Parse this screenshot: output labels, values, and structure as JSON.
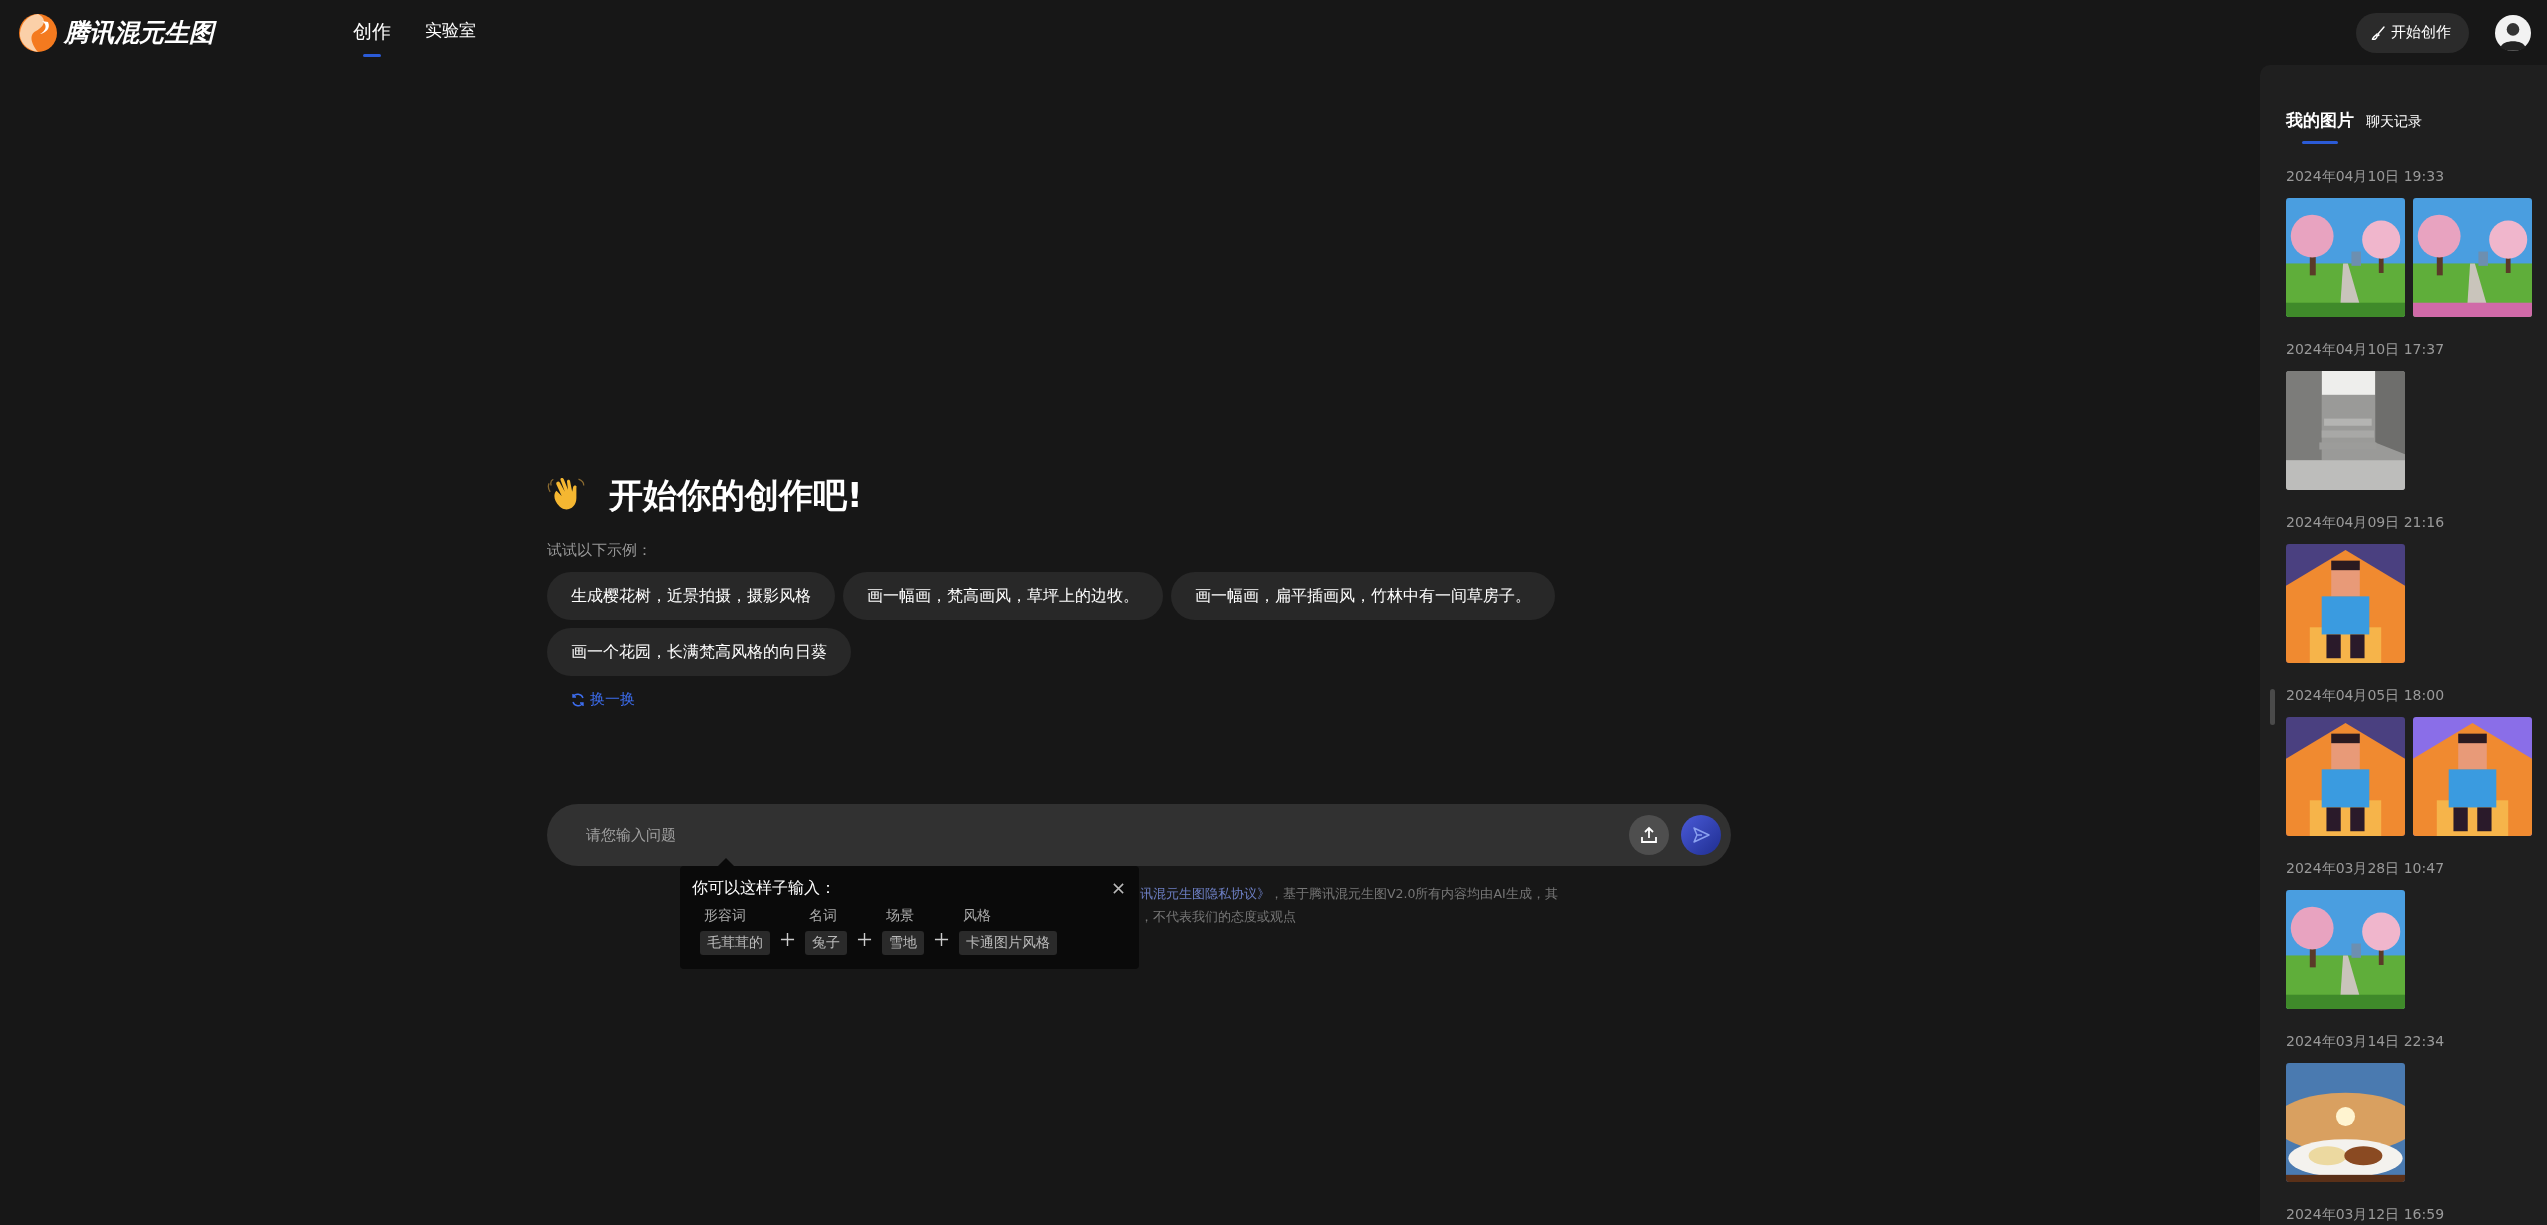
{
  "header": {
    "logo_text": "腾讯混元生图",
    "nav": [
      {
        "label": "创作",
        "selected": true
      },
      {
        "label": "实验室",
        "selected": false
      }
    ],
    "create_button": "开始创作"
  },
  "main": {
    "heading": "开始你的创作吧!",
    "examples_label": "试试以下示例：",
    "examples": [
      "生成樱花树，近景拍摄，摄影风格",
      "画一幅画，梵高画风，草坪上的边牧。",
      "画一幅画，扁平插画风，竹林中有一间草房子。",
      "画一个花园，长满梵高风格的向日葵"
    ],
    "refresh": "换一换",
    "input": {
      "placeholder": "请您输入问题"
    },
    "hint": {
      "title": "你可以这样子输入：",
      "parts": [
        {
          "label": "形容词",
          "example": "毛茸茸的"
        },
        {
          "label": "名词",
          "example": "兔子"
        },
        {
          "label": "场景",
          "example": "雪地"
        },
        {
          "label": "风格",
          "example": "卡通图片风格"
        }
      ]
    },
    "disclaimer": {
      "link": "讯混元生图隐私协议》",
      "line_1": "，基于腾讯混元生图V2.0所有内容均由AI生成，其",
      "line_2": "，不代表我们的态度或观点"
    }
  },
  "sidebar": {
    "tabs": [
      {
        "label": "我的图片",
        "selected": true
      },
      {
        "label": "聊天记录",
        "selected": false
      }
    ],
    "groups": [
      {
        "date": "2024年04月10日 19:33"
      },
      {
        "date": "2024年04月10日 17:37"
      },
      {
        "date": "2024年04月09日 21:16"
      },
      {
        "date": "2024年04月05日 18:00"
      },
      {
        "date": "2024年03月28日 10:47"
      },
      {
        "date": "2024年03月14日 22:34"
      },
      {
        "date": "2024年03月12日 16:59"
      }
    ]
  }
}
